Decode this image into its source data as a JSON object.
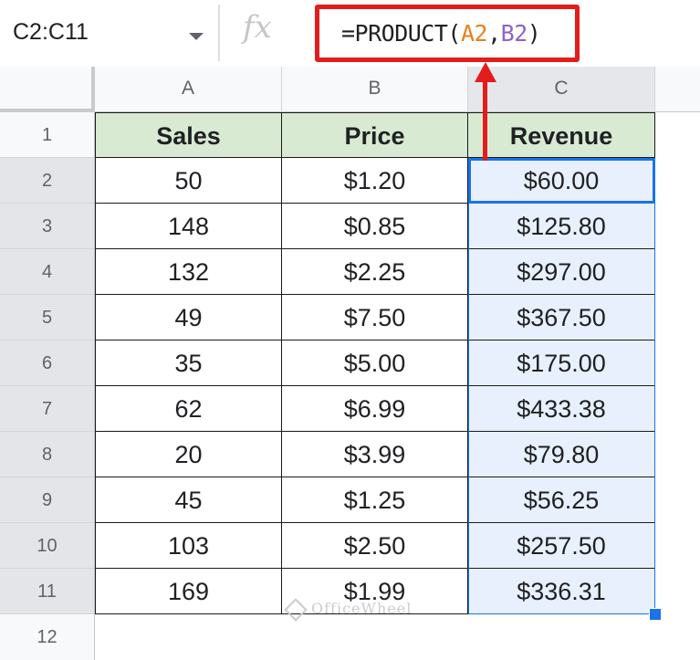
{
  "name_box": {
    "value": "C2:C11"
  },
  "formula_bar": {
    "fx_label": "fx",
    "formula_prefix": "=PRODUCT(",
    "arg1": "A2",
    "separator": ",",
    "arg2": "B2",
    "formula_suffix": ")"
  },
  "columns": [
    "A",
    "B",
    "C"
  ],
  "rows": [
    "1",
    "2",
    "3",
    "4",
    "5",
    "6",
    "7",
    "8",
    "9",
    "10",
    "11",
    "12"
  ],
  "table": {
    "headers": [
      "Sales",
      "Price",
      "Revenue"
    ],
    "data": [
      [
        "50",
        "$1.20",
        "$60.00"
      ],
      [
        "148",
        "$0.85",
        "$125.80"
      ],
      [
        "132",
        "$2.25",
        "$297.00"
      ],
      [
        "49",
        "$7.50",
        "$367.50"
      ],
      [
        "35",
        "$5.00",
        "$175.00"
      ],
      [
        "62",
        "$6.99",
        "$433.38"
      ],
      [
        "20",
        "$3.99",
        "$79.80"
      ],
      [
        "45",
        "$1.25",
        "$56.25"
      ],
      [
        "103",
        "$2.50",
        "$257.50"
      ],
      [
        "169",
        "$1.99",
        "$336.31"
      ]
    ]
  },
  "watermark": {
    "text": "OfficeWheel"
  },
  "colors": {
    "header_fill": "#d9ead3",
    "selection_fill": "#e8f0fd",
    "selection_border": "#1a73e8",
    "annotation_red": "#e31c1c",
    "ref_a": "#e8821e",
    "ref_b": "#9061c9"
  }
}
